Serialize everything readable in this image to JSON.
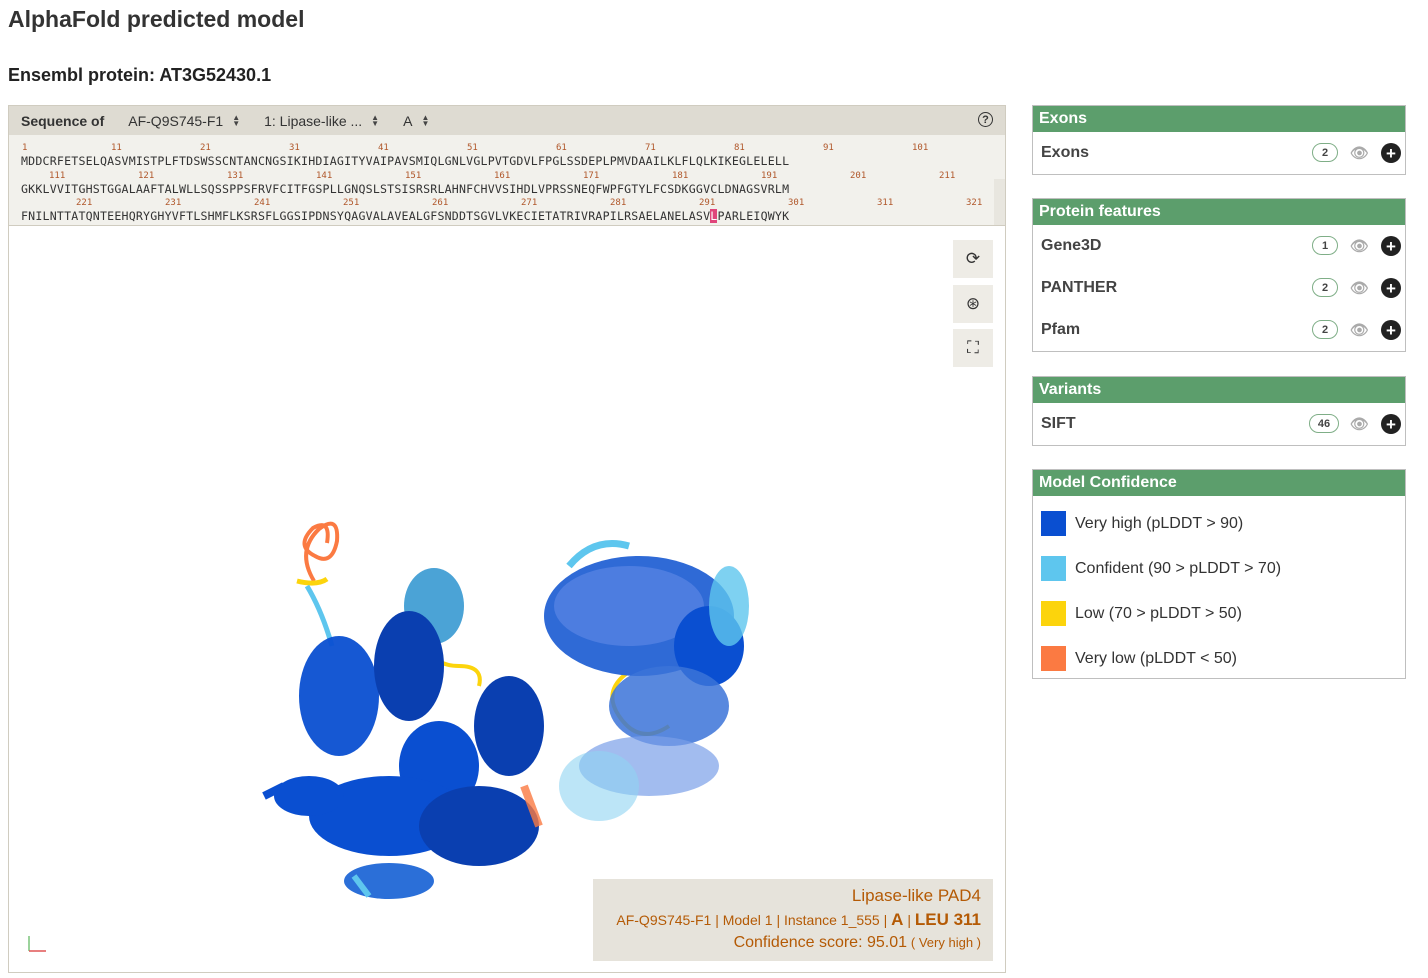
{
  "page": {
    "title": "AlphaFold predicted model",
    "subtitle": "Ensembl protein: AT3G52430.1"
  },
  "toolbar": {
    "sequence_label": "Sequence of",
    "model_select": "AF-Q9S745-F1",
    "entity_select": "1: Lipase-like ...",
    "chain_select": "A",
    "help_icon": "?"
  },
  "sequence": {
    "lines": [
      {
        "numbers": [
          "1",
          "11",
          "21",
          "31",
          "41",
          "51",
          "61",
          "71",
          "81",
          "91",
          "101"
        ],
        "residues": "MDDCRFETSELQASVMISTPLFTDSWSSCNTANCNGSIKIHDIAGITYVAIPAVSMIQLGNLVGLPVTGDVLFPGLSSDEPLPMVDAAILKLFLQLKIKEGLELELL"
      },
      {
        "numbers": [
          "111",
          "121",
          "131",
          "141",
          "151",
          "161",
          "171",
          "181",
          "191",
          "201",
          "211"
        ],
        "residues": "GKKLVVITGHSTGGALAAFTALWLLSQSSPPSFRVFCITFGSPLLGNQSLSTSISRSRLAHNFCHVVSIHDLVPRSSNEQFWPFGTYLFCSDKGGVCLDNAGSVRLM"
      },
      {
        "numbers": [
          "221",
          "231",
          "241",
          "251",
          "261",
          "271",
          "281",
          "291",
          "301",
          "311",
          "321"
        ],
        "residues_before": "FNILNTTATQNTEEHQRYGHYVFTLSHMFLKSRSFLGGSIPDNSYQAGVALAVEALGFSNDDTSGVLVKECIETATRIVRAPILRSAELANELASV",
        "residue_highlight": "L",
        "residues_after": "PARLEIQWYK"
      }
    ]
  },
  "info": {
    "protein_name": "Lipase-like PAD4",
    "model_id": "AF-Q9S745-F1",
    "model": "Model 1",
    "instance": "Instance 1_555",
    "chain": "A",
    "residue": "LEU 311",
    "confidence_label": "Confidence score: 95.01",
    "confidence_class": "( Very high )",
    "separator": "|"
  },
  "panels": {
    "exons": {
      "title": "Exons",
      "tracks": [
        {
          "label": "Exons",
          "count": "2"
        }
      ]
    },
    "protein_features": {
      "title": "Protein features",
      "tracks": [
        {
          "label": "Gene3D",
          "count": "1"
        },
        {
          "label": "PANTHER",
          "count": "2"
        },
        {
          "label": "Pfam",
          "count": "2"
        }
      ]
    },
    "variants": {
      "title": "Variants",
      "tracks": [
        {
          "label": "SIFT",
          "count": "46"
        }
      ]
    },
    "model_confidence": {
      "title": "Model Confidence",
      "items": [
        {
          "label": "Very high (pLDDT > 90)",
          "color": "#0a4fd1"
        },
        {
          "label": "Confident (90 > pLDDT > 70)",
          "color": "#5ec6ee"
        },
        {
          "label": "Low (70 > pLDDT > 50)",
          "color": "#fcd40c"
        },
        {
          "label": "Very low (pLDDT < 50)",
          "color": "#fb7a42"
        }
      ]
    }
  },
  "icons": {
    "reset": "reset-icon",
    "screenshot": "camera-icon",
    "fullscreen": "fullscreen-icon",
    "hide": "eye-slash-icon",
    "add": "plus-icon"
  }
}
